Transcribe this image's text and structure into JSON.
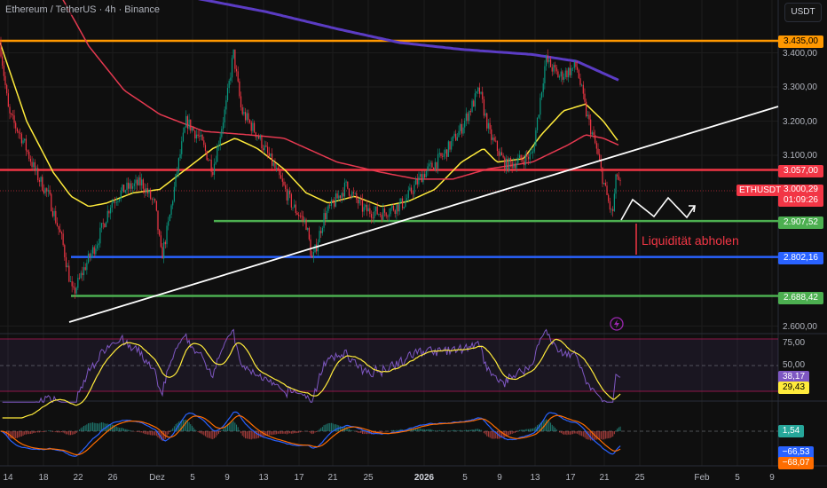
{
  "header": {
    "title": "Ethereum / TetherUS · 4h · Binance",
    "currency_button": "USDT"
  },
  "symbol_tag": "ETHUSDT",
  "annotation": "Liquidität abholen",
  "colors": {
    "bg": "#0f0f0f",
    "up": "#089981",
    "down": "#f23645",
    "orange": "#ff9800",
    "green": "#4caf50",
    "blue": "#2962ff",
    "purple": "#673ab7",
    "yellow": "#ffeb3b",
    "rsi": "#7e57c2"
  },
  "price_axis": {
    "labels": [
      "3.400,00",
      "3.300,00",
      "3.200,00",
      "3.100,00",
      "2.600,00"
    ],
    "values": [
      3400,
      3300,
      3200,
      3100,
      2600
    ]
  },
  "levels": [
    {
      "name": "resistance-3435",
      "label": "3.435,00",
      "value": 3435,
      "color": "#ff9800"
    },
    {
      "name": "resistance-3057",
      "label": "3.057,00",
      "value": 3057,
      "color": "#f23645"
    },
    {
      "name": "support-2907",
      "label": "2.907,52",
      "value": 2907.52,
      "color": "#4caf50"
    },
    {
      "name": "support-2802",
      "label": "2.802,16",
      "value": 2802.16,
      "color": "#2962ff"
    },
    {
      "name": "support-2688",
      "label": "2.688,42",
      "value": 2688.42,
      "color": "#4caf50"
    }
  ],
  "last_price": {
    "label": "3.000,29",
    "value": 3000.29,
    "countdown": "01:09:26"
  },
  "rsi": {
    "axis": [
      "75,00",
      "50,00"
    ],
    "rsi_value": "38,17",
    "ma_value": "29,43"
  },
  "macd": {
    "hist_value": "1,54",
    "macd_value": "−66,53",
    "signal_value": "−68,07"
  },
  "time_axis": [
    "14",
    "18",
    "22",
    "26",
    "Dez",
    "5",
    "9",
    "13",
    "17",
    "21",
    "25",
    "2026",
    "5",
    "9",
    "13",
    "17",
    "21",
    "25",
    "Feb",
    "5",
    "9"
  ],
  "chart_data": {
    "type": "candlestick",
    "title": "Ethereum / TetherUS · 4h · Binance",
    "ylim": [
      2600,
      3450
    ],
    "price_path_key_points": [
      [
        0,
        3430
      ],
      [
        10,
        3220
      ],
      [
        25,
        3150
      ],
      [
        40,
        3050
      ],
      [
        55,
        2980
      ],
      [
        70,
        2850
      ],
      [
        82,
        2690
      ],
      [
        95,
        2770
      ],
      [
        110,
        2850
      ],
      [
        125,
        2960
      ],
      [
        140,
        3000
      ],
      [
        160,
        3020
      ],
      [
        175,
        2950
      ],
      [
        182,
        2800
      ],
      [
        190,
        2900
      ],
      [
        200,
        3060
      ],
      [
        210,
        3200
      ],
      [
        225,
        3150
      ],
      [
        240,
        3060
      ],
      [
        255,
        3250
      ],
      [
        263,
        3400
      ],
      [
        272,
        3230
      ],
      [
        290,
        3160
      ],
      [
        310,
        3060
      ],
      [
        330,
        2950
      ],
      [
        345,
        2900
      ],
      [
        352,
        2790
      ],
      [
        365,
        2920
      ],
      [
        390,
        3010
      ],
      [
        410,
        2940
      ],
      [
        430,
        2930
      ],
      [
        455,
        2960
      ],
      [
        475,
        3040
      ],
      [
        500,
        3100
      ],
      [
        520,
        3180
      ],
      [
        540,
        3290
      ],
      [
        552,
        3160
      ],
      [
        570,
        3070
      ],
      [
        600,
        3100
      ],
      [
        615,
        3380
      ],
      [
        630,
        3330
      ],
      [
        650,
        3360
      ],
      [
        660,
        3230
      ],
      [
        672,
        3120
      ],
      [
        682,
        3000
      ],
      [
        690,
        2920
      ],
      [
        695,
        3050
      ],
      [
        700,
        3000
      ]
    ],
    "ma_yellow": [
      [
        0,
        3430
      ],
      [
        30,
        3200
      ],
      [
        60,
        3050
      ],
      [
        80,
        2980
      ],
      [
        100,
        2950
      ],
      [
        120,
        2960
      ],
      [
        150,
        2990
      ],
      [
        180,
        3000
      ],
      [
        210,
        3060
      ],
      [
        240,
        3120
      ],
      [
        265,
        3150
      ],
      [
        290,
        3120
      ],
      [
        320,
        3060
      ],
      [
        345,
        2990
      ],
      [
        370,
        2960
      ],
      [
        400,
        2980
      ],
      [
        430,
        2950
      ],
      [
        460,
        2965
      ],
      [
        490,
        3000
      ],
      [
        520,
        3080
      ],
      [
        545,
        3120
      ],
      [
        560,
        3080
      ],
      [
        590,
        3090
      ],
      [
        610,
        3160
      ],
      [
        635,
        3230
      ],
      [
        660,
        3250
      ],
      [
        680,
        3200
      ],
      [
        697,
        3140
      ]
    ],
    "ma_red": [
      [
        70,
        3560
      ],
      [
        100,
        3420
      ],
      [
        140,
        3290
      ],
      [
        180,
        3220
      ],
      [
        230,
        3170
      ],
      [
        280,
        3160
      ],
      [
        320,
        3150
      ],
      [
        380,
        3080
      ],
      [
        430,
        3050
      ],
      [
        470,
        3030
      ],
      [
        510,
        3030
      ],
      [
        550,
        3060
      ],
      [
        600,
        3080
      ],
      [
        640,
        3130
      ],
      [
        660,
        3160
      ],
      [
        680,
        3150
      ],
      [
        697,
        3130
      ]
    ],
    "ma_purple": [
      [
        220,
        3560
      ],
      [
        300,
        3520
      ],
      [
        380,
        3470
      ],
      [
        450,
        3430
      ],
      [
        520,
        3410
      ],
      [
        600,
        3395
      ],
      [
        650,
        3375
      ],
      [
        697,
        3320
      ]
    ]
  }
}
